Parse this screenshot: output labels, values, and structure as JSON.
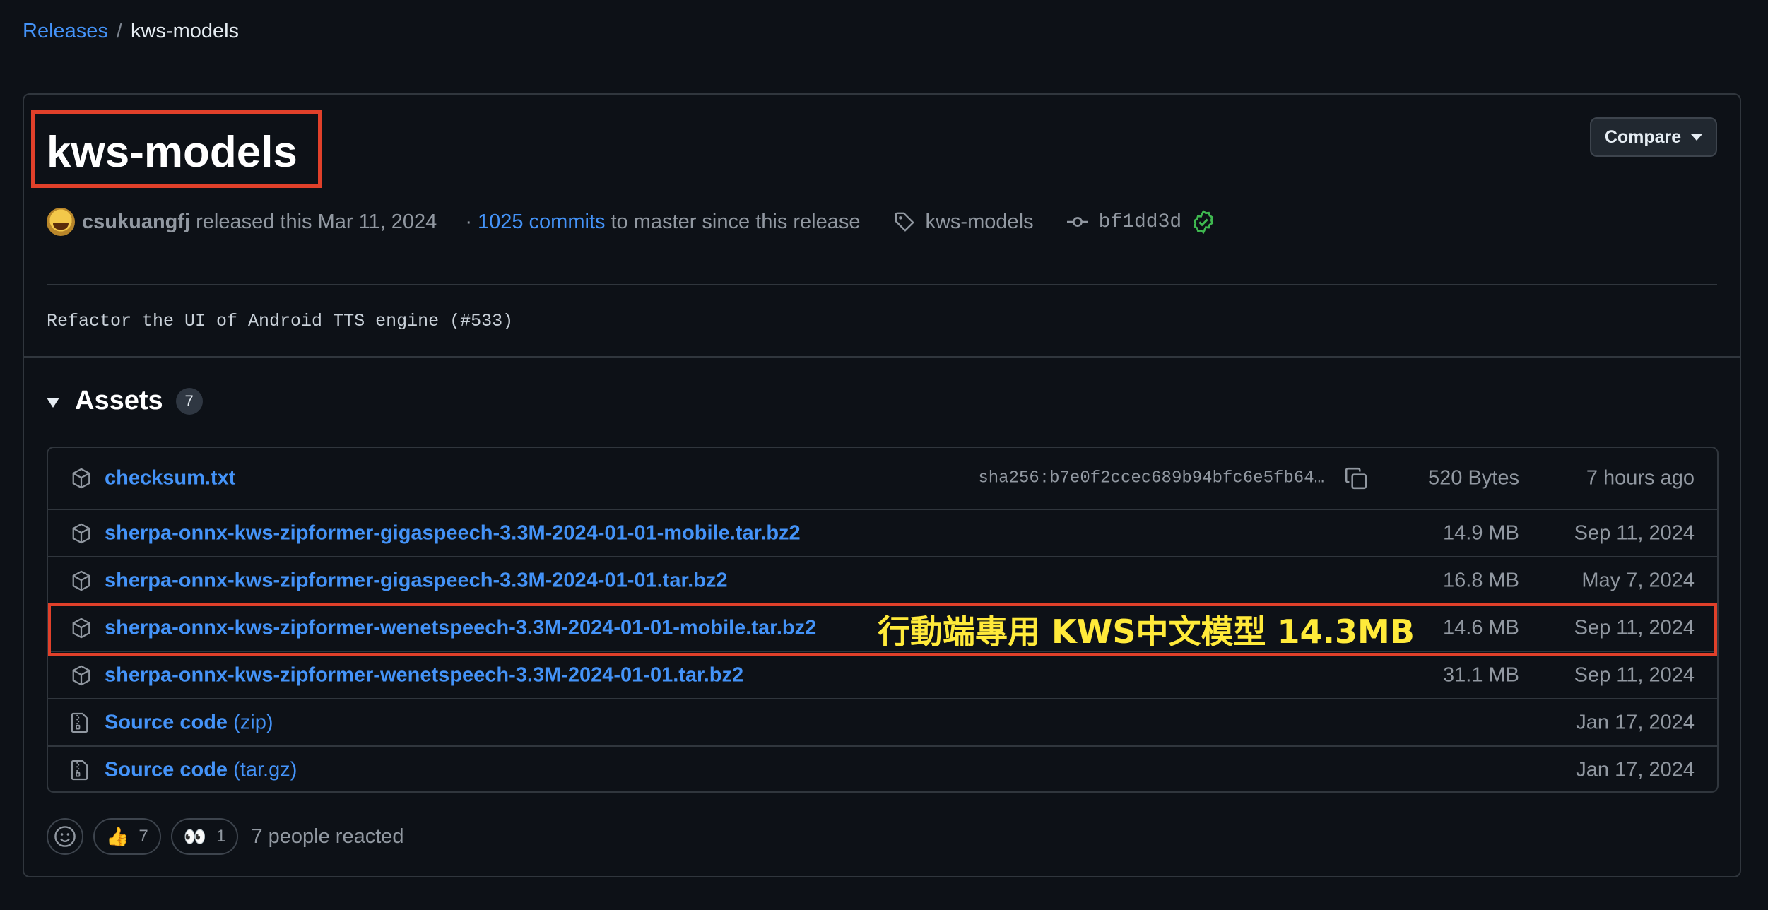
{
  "breadcrumb": {
    "parent": "Releases",
    "separator": "/",
    "current": "kws-models"
  },
  "release": {
    "title": "kws-models",
    "compare_label": "Compare",
    "author": "csukuangfj",
    "released_text": "released this Mar 11, 2024",
    "dot": "·",
    "commits_link": "1025 commits",
    "commits_suffix": "to master since this release",
    "tag": "kws-models",
    "commit_sha": "bf1dd3d",
    "body": "Refactor the UI of Android TTS engine (#533)"
  },
  "assets": {
    "title": "Assets",
    "count": "7",
    "rows": [
      {
        "name": "checksum.txt",
        "sha": "sha256:b7e0f2ccec689b94bfc6e5fb64…",
        "size": "520 Bytes",
        "date": "7 hours ago"
      },
      {
        "name": "sherpa-onnx-kws-zipformer-gigaspeech-3.3M-2024-01-01-mobile.tar.bz2",
        "size": "14.9 MB",
        "date": "Sep 11, 2024"
      },
      {
        "name": "sherpa-onnx-kws-zipformer-gigaspeech-3.3M-2024-01-01.tar.bz2",
        "size": "16.8 MB",
        "date": "May 7, 2024"
      },
      {
        "name": "sherpa-onnx-kws-zipformer-wenetspeech-3.3M-2024-01-01-mobile.tar.bz2",
        "size": "14.6 MB",
        "date": "Sep 11, 2024"
      },
      {
        "name": "sherpa-onnx-kws-zipformer-wenetspeech-3.3M-2024-01-01.tar.bz2",
        "size": "31.1 MB",
        "date": "Sep 11, 2024"
      },
      {
        "name": "Source code",
        "ext": "(zip)",
        "date": "Jan 17, 2024"
      },
      {
        "name": "Source code",
        "ext": "(tar.gz)",
        "date": "Jan 17, 2024"
      }
    ]
  },
  "annotation": "行動端專用 KWS中文模型  14.3MB",
  "reactions": {
    "thumbs_up_count": "7",
    "eyes_count": "1",
    "summary": "7 people reacted"
  },
  "colors": {
    "background": "#0d1117",
    "link": "#4493f8",
    "highlight": "#e0402a",
    "annotation": "#ffea3a",
    "verified": "#3fb950"
  }
}
